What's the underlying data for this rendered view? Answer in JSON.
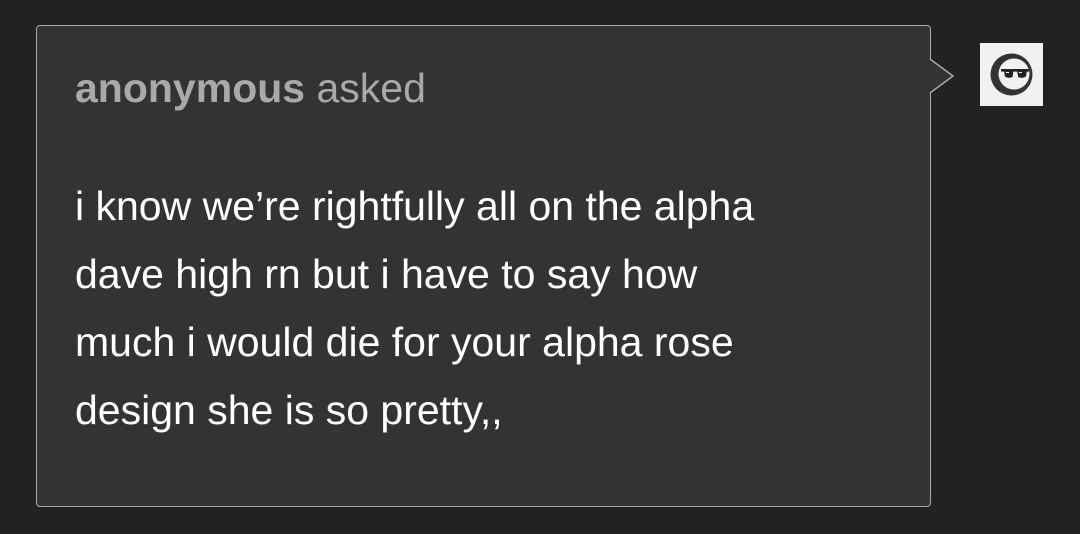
{
  "ask": {
    "asker": "anonymous",
    "verb": "asked",
    "lines": [
      "i know we’re rightfully all on the alpha",
      "dave high rn but i have to say how",
      "much i would die for your alpha rose",
      "design she is so pretty,,"
    ]
  },
  "avatar": {
    "icon": "anonymous-sunglasses-avatar-icon"
  },
  "colors": {
    "page_background": "#222222",
    "bubble_background": "#333333",
    "bubble_border": "#a8a8a8",
    "header_text": "#a9a9a9",
    "body_text": "#ffffff"
  }
}
